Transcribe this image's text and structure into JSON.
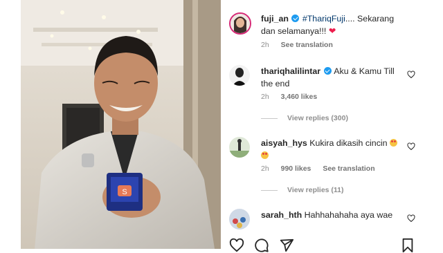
{
  "post": {
    "caption": {
      "username": "fuji_an",
      "hashtag": "#ThariqFuji",
      "text": ".... Sekarang dan selamanya!!!",
      "emoji": "❤",
      "time": "2h",
      "translate": "See translation"
    },
    "comments": [
      {
        "username": "thariqhalilintar",
        "verified": true,
        "text": "Aku & Kamu Till the end",
        "time": "2h",
        "likes": "3,460 likes",
        "view_replies": "View replies (300)"
      },
      {
        "username": "aisyah_hys",
        "verified": false,
        "text": "Kukira dikasih cincin",
        "time": "2h",
        "likes": "990 likes",
        "translate": "See translation",
        "view_replies": "View replies (11)"
      },
      {
        "username": "sarah_hth",
        "verified": false,
        "text": "Hahhahahaha aya wae"
      }
    ],
    "actions": [
      "heart-icon",
      "comment-icon",
      "share-icon",
      "save-icon"
    ]
  },
  "colors": {
    "verified": "#1d9bf0",
    "heart_red": "#ed1d4d",
    "muted": "#8e8e8e"
  }
}
